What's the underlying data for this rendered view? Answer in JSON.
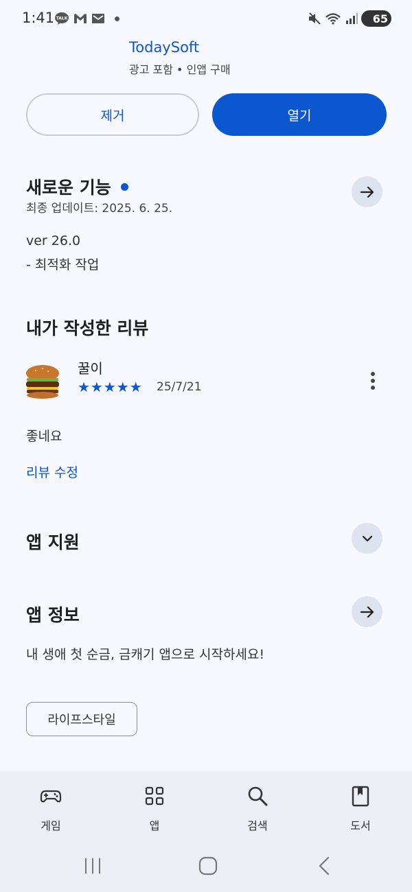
{
  "status_bar": {
    "time": "1:41",
    "battery": "65"
  },
  "app": {
    "developer": "TodaySoft",
    "flags": "광고 포함 • 인앱 구매"
  },
  "actions": {
    "remove_label": "제거",
    "open_label": "열기"
  },
  "whats_new": {
    "title": "새로운 기능",
    "updated": "최종 업데이트: 2025. 6. 25.",
    "version": "ver 26.0",
    "notes": "- 최적화 작업"
  },
  "my_review": {
    "title": "내가 작성한 리뷰",
    "author": "꿀이",
    "rating": 5,
    "stars": "★★★★★",
    "date": "25/7/21",
    "text": "좋네요",
    "edit_label": "리뷰 수정"
  },
  "app_support": {
    "title": "앱 지원"
  },
  "app_info": {
    "title": "앱 정보",
    "description": "내 생애 첫 순금, 금캐기 앱으로 시작하세요!",
    "category": "라이프스타일"
  },
  "bottom_nav": [
    {
      "label": "게임",
      "icon": "gamepad-icon"
    },
    {
      "label": "앱",
      "icon": "apps-grid-icon"
    },
    {
      "label": "검색",
      "icon": "search-icon"
    },
    {
      "label": "도서",
      "icon": "book-icon"
    }
  ],
  "colors": {
    "accent": "#0b57d0",
    "background": "#f8f9fe",
    "nav_background": "#eceff6"
  }
}
